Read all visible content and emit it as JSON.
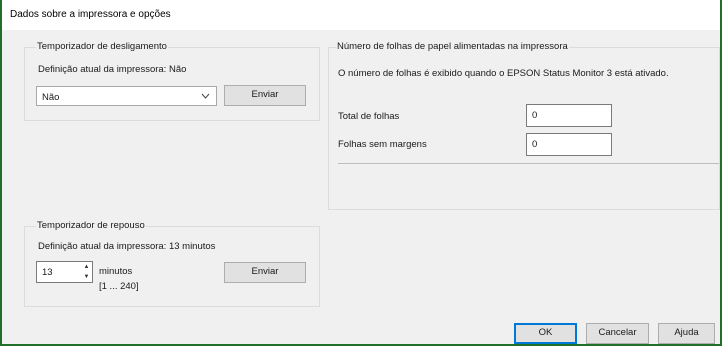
{
  "window": {
    "title": "Dados sobre a impressora e opções"
  },
  "shutdown_timer": {
    "group_label": "Temporizador de desligamento",
    "current_setting": "Definição atual da impressora: Não",
    "select_value": "Não",
    "send_label": "Enviar"
  },
  "sheets": {
    "group_label": "Número de folhas de papel alimentadas na impressora",
    "info": "O número de folhas é exibido quando o EPSON Status Monitor 3 está ativado.",
    "total_label": "Total de folhas",
    "total_value": "0",
    "borderless_label": "Folhas sem margens",
    "borderless_value": "0"
  },
  "sleep_timer": {
    "group_label": "Temporizador de repouso",
    "current_setting": "Definição atual da impressora: 13 minutos",
    "value": "13",
    "unit": "minutos",
    "range": "[1 ... 240]",
    "send_label": "Enviar"
  },
  "footer": {
    "ok_label": "OK",
    "cancel_label": "Cancelar",
    "help_label": "Ajuda"
  }
}
